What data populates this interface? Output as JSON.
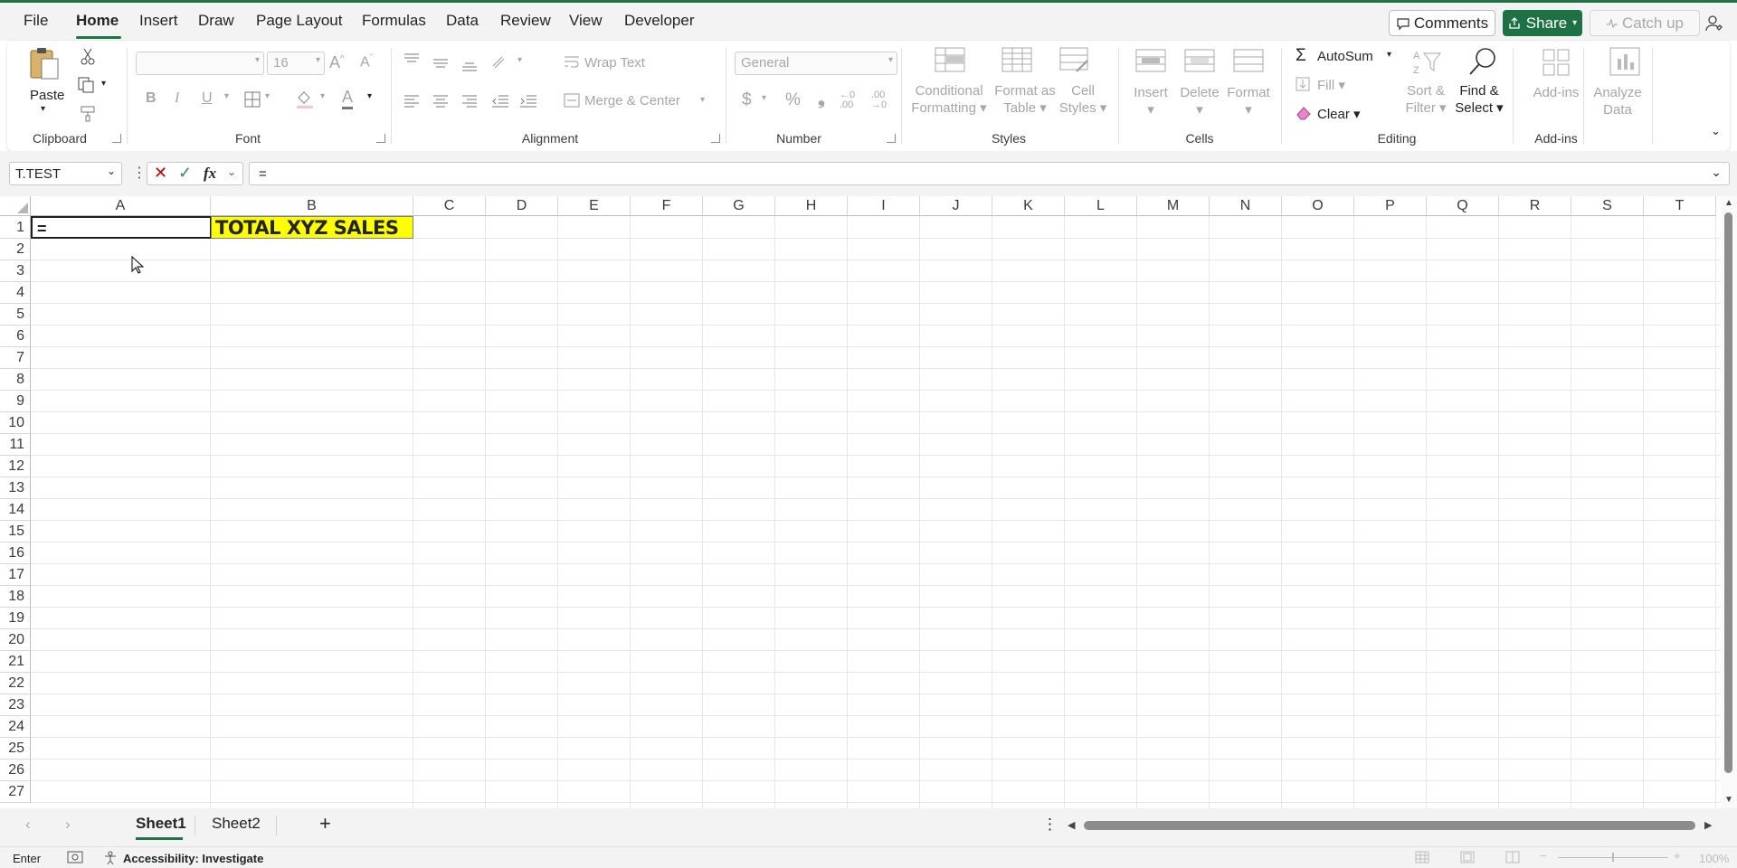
{
  "menu": {
    "items": [
      {
        "id": "file",
        "label": "File",
        "active": false
      },
      {
        "id": "home",
        "label": "Home",
        "active": true
      },
      {
        "id": "insert",
        "label": "Insert",
        "active": false
      },
      {
        "id": "draw",
        "label": "Draw",
        "active": false
      },
      {
        "id": "page-layout",
        "label": "Page Layout",
        "active": false
      },
      {
        "id": "formulas",
        "label": "Formulas",
        "active": false
      },
      {
        "id": "data",
        "label": "Data",
        "active": false
      },
      {
        "id": "review",
        "label": "Review",
        "active": false
      },
      {
        "id": "view",
        "label": "View",
        "active": false
      },
      {
        "id": "developer",
        "label": "Developer",
        "active": false
      }
    ],
    "comments_label": "Comments",
    "share_label": "Share",
    "catchup_label": "Catch up"
  },
  "ribbon": {
    "clipboard": {
      "paste_label": "Paste",
      "group_label": "Clipboard"
    },
    "font": {
      "font_name": "",
      "font_size": "16",
      "group_label": "Font"
    },
    "alignment": {
      "wrap_label": "Wrap Text",
      "merge_label": "Merge & Center",
      "group_label": "Alignment"
    },
    "number": {
      "format": "General",
      "group_label": "Number"
    },
    "styles": {
      "cond_line1": "Conditional",
      "cond_line2": "Formatting",
      "table_line1": "Format as",
      "table_line2": "Table",
      "cell_line1": "Cell",
      "cell_line2": "Styles",
      "group_label": "Styles"
    },
    "cells": {
      "insert_label": "Insert",
      "delete_label": "Delete",
      "format_label": "Format",
      "group_label": "Cells"
    },
    "editing": {
      "autosum_label": "AutoSum",
      "fill_label": "Fill",
      "clear_label": "Clear",
      "sort_line1": "Sort &",
      "sort_line2": "Filter",
      "find_line1": "Find &",
      "find_line2": "Select",
      "group_label": "Editing"
    },
    "addins": {
      "addins_label": "Add-ins",
      "group_label": "Add-ins"
    },
    "analyze": {
      "line1": "Analyze",
      "line2": "Data"
    }
  },
  "formula_bar": {
    "name_box": "T.TEST",
    "formula": "="
  },
  "sheet": {
    "columns": [
      "A",
      "B",
      "C",
      "D",
      "E",
      "F",
      "G",
      "H",
      "I",
      "J",
      "K",
      "L",
      "M",
      "N",
      "O",
      "P",
      "Q",
      "R",
      "S",
      "T"
    ],
    "rows": [
      "1",
      "2",
      "3",
      "4",
      "5",
      "6",
      "7",
      "8",
      "9",
      "10",
      "11",
      "12",
      "13",
      "14",
      "15",
      "16",
      "17",
      "18",
      "19",
      "20",
      "21",
      "22",
      "23",
      "24",
      "25",
      "26",
      "27"
    ],
    "cell_a1": "=",
    "cell_b1": "TOTAL XYZ SALES",
    "colors": {
      "b1_fill": "#ffff00",
      "accent": "#217346"
    }
  },
  "tabs": {
    "sheet1": "Sheet1",
    "sheet2": "Sheet2"
  },
  "status": {
    "mode": "Enter",
    "accessibility": "Accessibility: Investigate",
    "zoom": "100%"
  }
}
